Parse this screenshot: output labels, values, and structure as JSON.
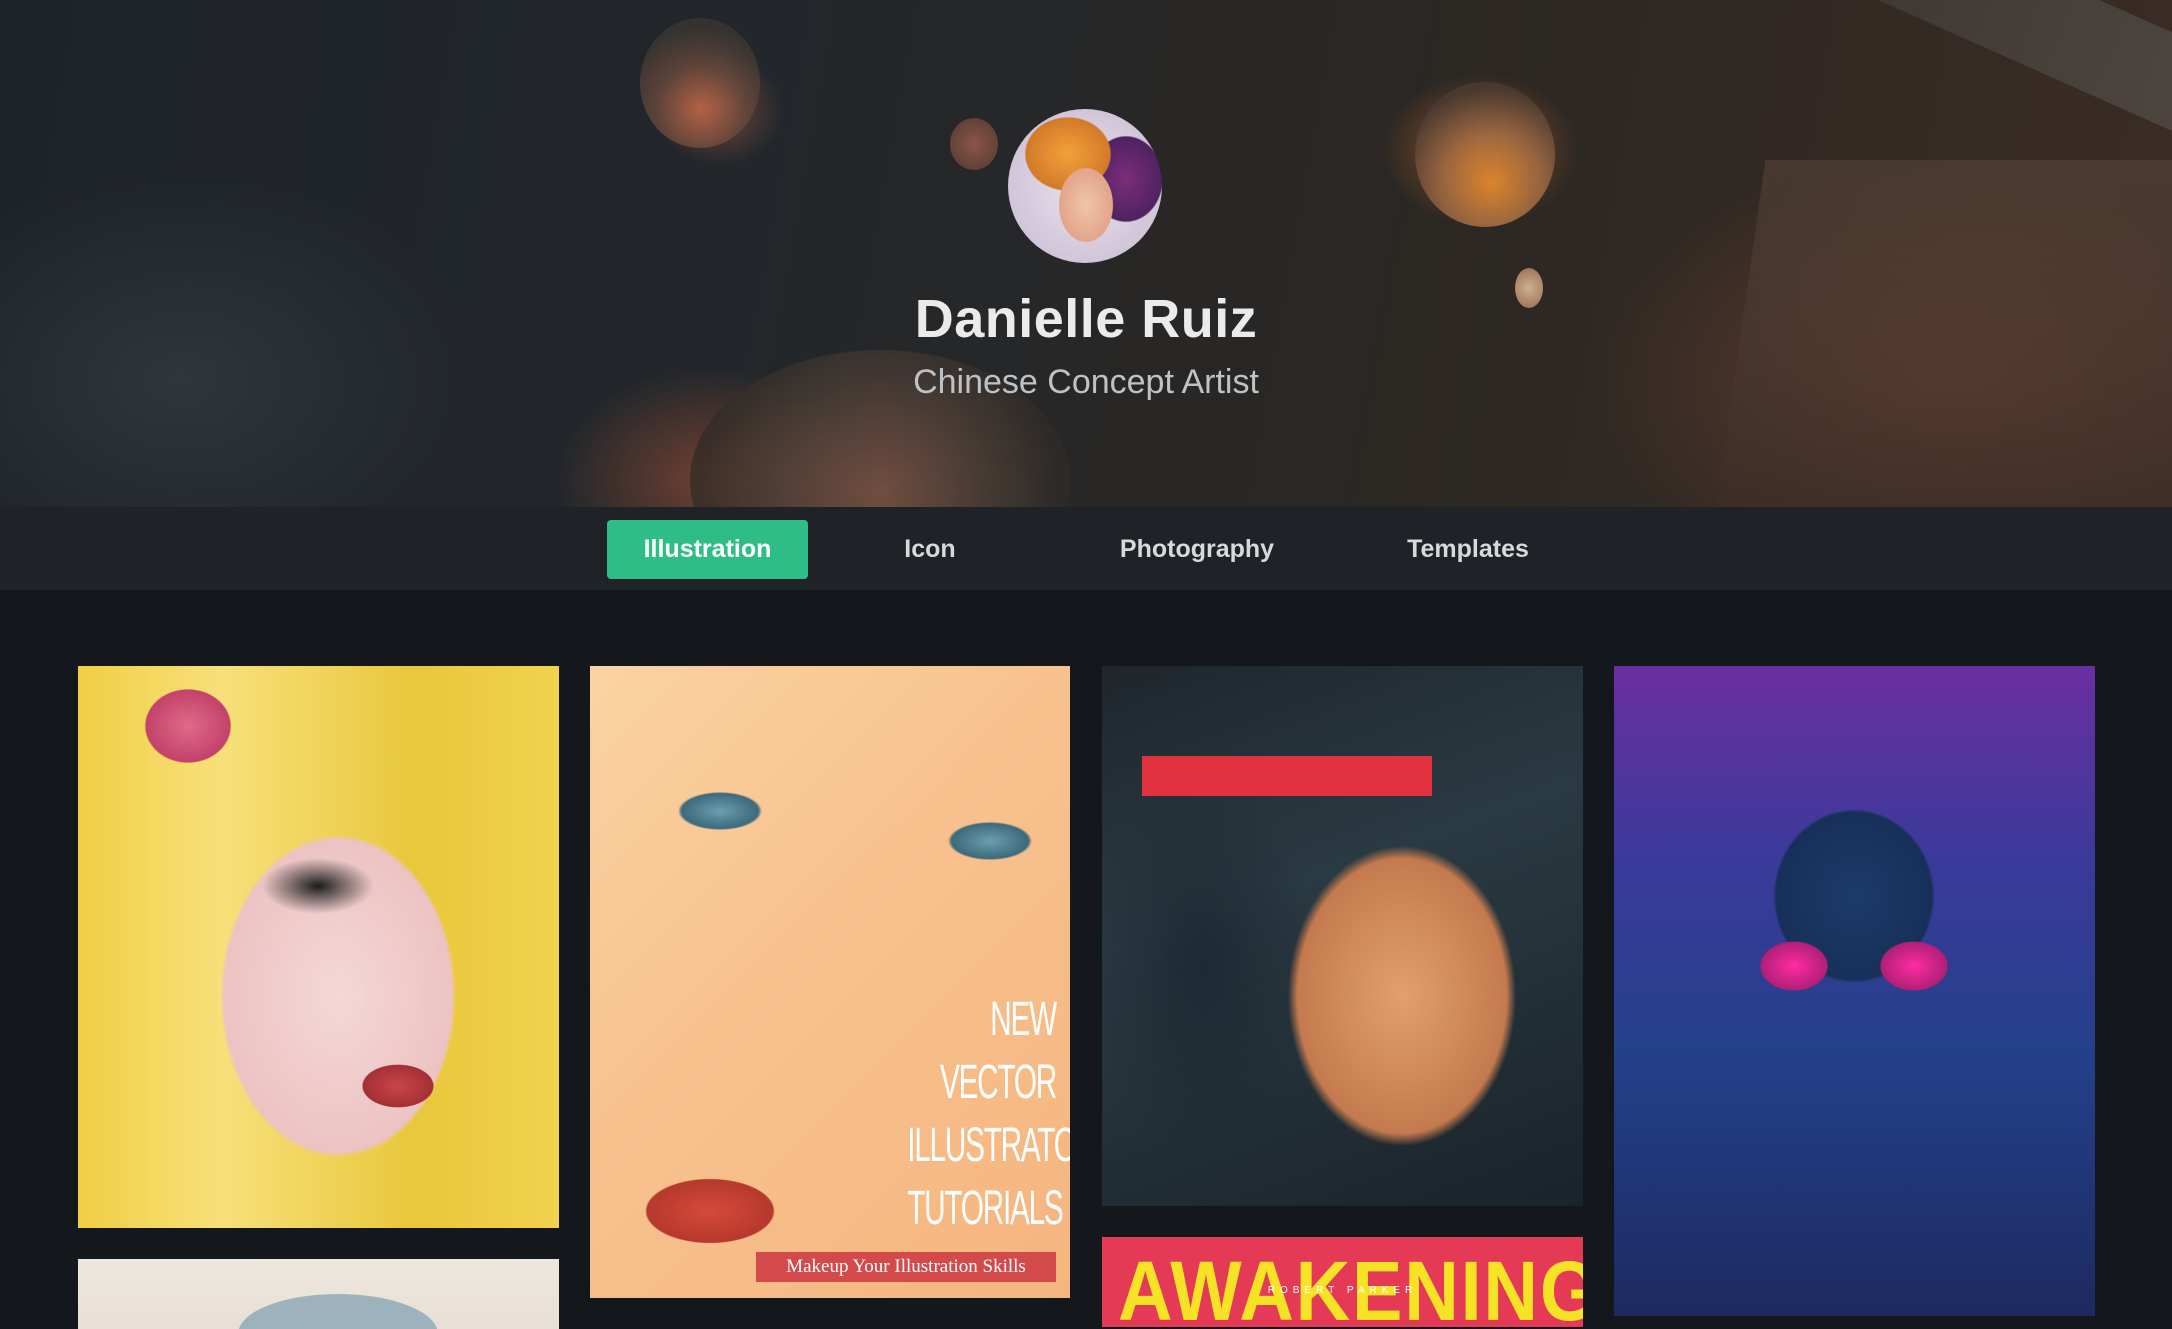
{
  "profile": {
    "name": "Danielle Ruiz",
    "title": "Chinese Concept Artist"
  },
  "tabs": [
    {
      "label": "Illustration",
      "active": true
    },
    {
      "label": "Icon",
      "active": false
    },
    {
      "label": "Photography",
      "active": false
    },
    {
      "label": "Templates",
      "active": false
    }
  ],
  "gallery": {
    "items": [
      {
        "name": "blonde-woman-illustration"
      },
      {
        "name": "vector-tutorials-poster",
        "poster_lines": [
          "NEW",
          "VECTOR",
          "ILLUSTRATOR",
          "TUTORIALS"
        ],
        "strip_text": "Makeup Your Illustration Skills"
      },
      {
        "name": "red-visor-woman-illustration"
      },
      {
        "name": "awesome-mix-cassette-illustration"
      },
      {
        "name": "portrait-illustration-partial"
      },
      {
        "name": "awakening-poster",
        "headline": "AWAKENING",
        "credit": "ROBERT PARKER"
      }
    ]
  },
  "colors": {
    "accent": "#2ebd86",
    "background": "#14181d",
    "tabbar": "#1f2328"
  }
}
